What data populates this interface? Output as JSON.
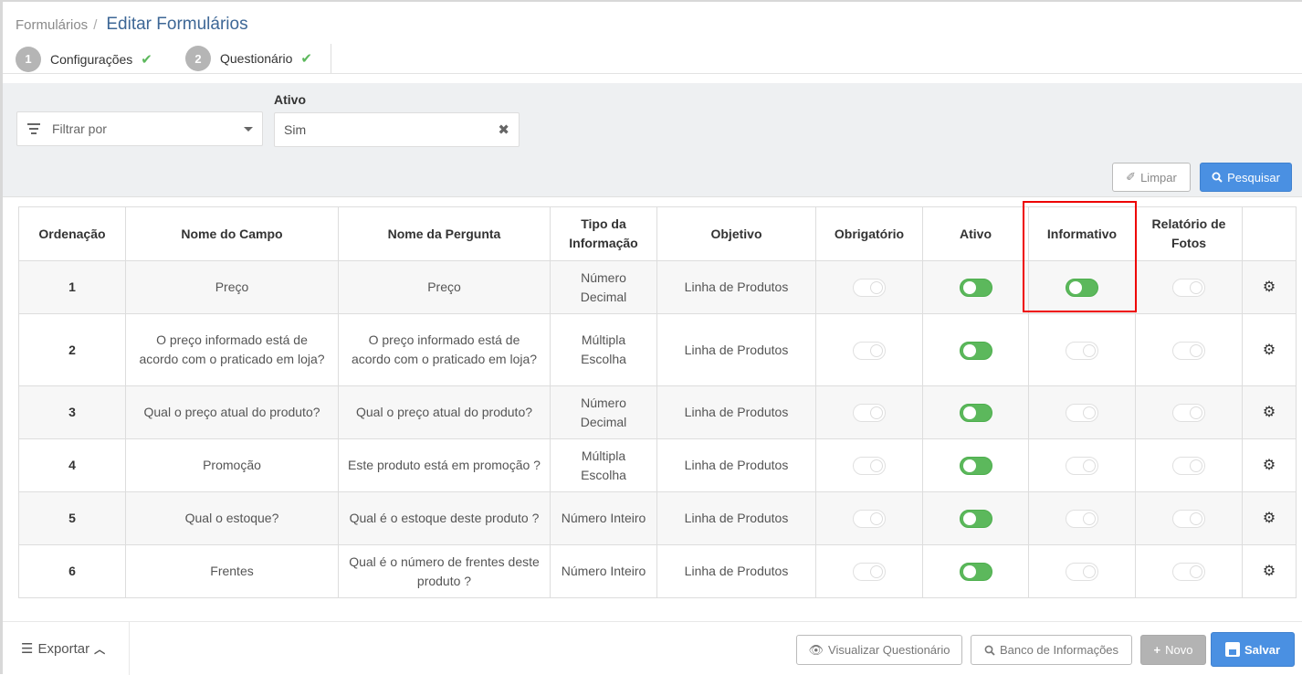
{
  "breadcrumb": {
    "parent": "Formulários",
    "separator": "/",
    "current": "Editar Formulários"
  },
  "steps": [
    {
      "number": "1",
      "label": "Configurações"
    },
    {
      "number": "2",
      "label": "Questionário"
    }
  ],
  "filters": {
    "filter_placeholder": "Filtrar por",
    "ativo_label": "Ativo",
    "ativo_value": "Sim"
  },
  "buttons": {
    "limpar": "Limpar",
    "pesquisar": "Pesquisar"
  },
  "table": {
    "headers": [
      "Ordenação",
      "Nome do Campo",
      "Nome da Pergunta",
      "Tipo da Informação",
      "Objetivo",
      "Obrigatório",
      "Ativo",
      "Informativo",
      "Relatório de Fotos",
      ""
    ],
    "rows": [
      {
        "ordem": "1",
        "campo": "Preço",
        "pergunta": "Preço",
        "tipo": "Número Decimal",
        "objetivo": "Linha de Produtos",
        "obrigatorio": false,
        "ativo": true,
        "informativo": true,
        "relatorio_fotos": false
      },
      {
        "ordem": "2",
        "campo": "O preço informado está de acordo com o praticado em loja?",
        "pergunta": "O preço informado está de acordo com o praticado em loja?",
        "tipo": "Múltipla Escolha",
        "objetivo": "Linha de Produtos",
        "obrigatorio": false,
        "ativo": true,
        "informativo": false,
        "relatorio_fotos": false
      },
      {
        "ordem": "3",
        "campo": "Qual o preço atual do produto?",
        "pergunta": "Qual o preço atual do produto?",
        "tipo": "Número Decimal",
        "objetivo": "Linha de Produtos",
        "obrigatorio": false,
        "ativo": true,
        "informativo": false,
        "relatorio_fotos": false
      },
      {
        "ordem": "4",
        "campo": "Promoção",
        "pergunta": "Este produto está em promoção ?",
        "tipo": "Múltipla Escolha",
        "objetivo": "Linha de Produtos",
        "obrigatorio": false,
        "ativo": true,
        "informativo": false,
        "relatorio_fotos": false
      },
      {
        "ordem": "5",
        "campo": "Qual o estoque?",
        "pergunta": "Qual é o estoque deste produto ?",
        "tipo": "Número Inteiro",
        "objetivo": "Linha de Produtos",
        "obrigatorio": false,
        "ativo": true,
        "informativo": false,
        "relatorio_fotos": false
      },
      {
        "ordem": "6",
        "campo": "Frentes",
        "pergunta": "Qual é o número de frentes deste produto ?",
        "tipo": "Número Inteiro",
        "objetivo": "Linha de Produtos",
        "obrigatorio": false,
        "ativo": true,
        "informativo": false,
        "relatorio_fotos": false
      }
    ]
  },
  "footer": {
    "exportar": "Exportar",
    "visualizar": "Visualizar Questionário",
    "banco": "Banco de Informações",
    "novo": "Novo",
    "salvar": "Salvar"
  },
  "colors": {
    "accent": "#4a90e2",
    "toggle_on": "#5cb85c",
    "highlight": "#e00000",
    "title": "#3d6796"
  },
  "icons": [
    "filter-icon",
    "chevron-down-icon",
    "close-icon",
    "eraser-icon",
    "search-icon",
    "gear-icon",
    "list-icon",
    "chevron-up-icon",
    "eye-icon",
    "plus-icon",
    "save-icon",
    "check-icon"
  ]
}
